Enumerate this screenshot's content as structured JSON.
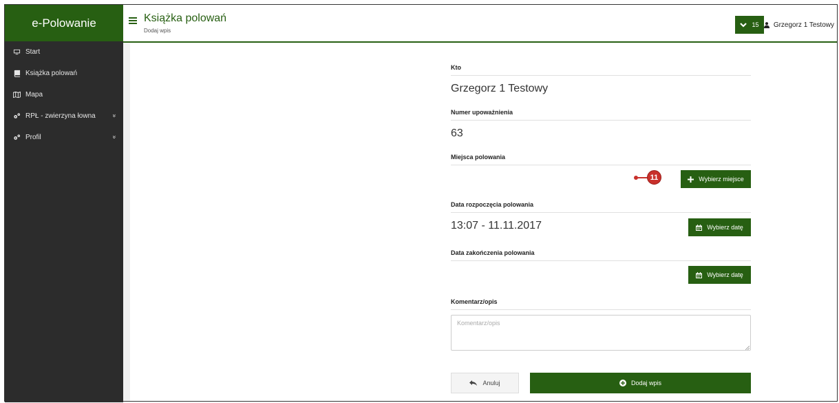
{
  "app": {
    "brand": "e-Polowanie"
  },
  "sidebar": {
    "items": [
      {
        "label": "Start"
      },
      {
        "label": "Książka polowań"
      },
      {
        "label": "Mapa"
      },
      {
        "label": "RPŁ - zwierzyna łowna",
        "chevron": "»"
      },
      {
        "label": "Profil",
        "chevron": "»"
      }
    ]
  },
  "header": {
    "title": "Książka polowań",
    "subtitle": "Dodaj wpis",
    "notifications_count": "15",
    "user_name": "Grzegorz 1 Testowy"
  },
  "form": {
    "who_label": "Kto",
    "who_value": "Grzegorz 1 Testowy",
    "permit_label": "Numer upoważnienia",
    "permit_value": "63",
    "places_label": "Miejsca polowania",
    "choose_place_label": "Wybierz miejsce",
    "start_label": "Data rozpoczęcia polowania",
    "start_value": "13:07 - 11.11.2017",
    "choose_date_label": "Wybierz datę",
    "end_label": "Data zakończenia polowania",
    "comment_label": "Komentarz/opis",
    "comment_placeholder": "Komentarz/opis",
    "comment_value": "",
    "cancel_label": "Anuluj",
    "submit_label": "Dodaj wpis"
  },
  "callout": {
    "number": "11"
  },
  "colors": {
    "brand_green": "#275f12",
    "sidebar_bg": "#2c2c2c",
    "callout_red": "#c8302b"
  }
}
